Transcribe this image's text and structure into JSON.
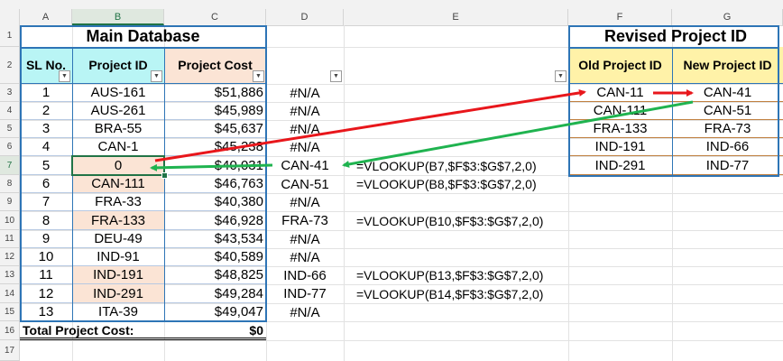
{
  "columns": [
    "A",
    "B",
    "C",
    "D",
    "E",
    "F",
    "G"
  ],
  "rows": [
    "1",
    "2",
    "3",
    "4",
    "5",
    "6",
    "7",
    "8",
    "9",
    "10",
    "11",
    "12",
    "13",
    "14",
    "15",
    "16",
    "17"
  ],
  "main_db": {
    "title": "Main Database",
    "headers": [
      "SL No.",
      "Project ID",
      "Project Cost"
    ],
    "records": [
      {
        "sl": "1",
        "id": "AUS-161",
        "cost": "$51,886",
        "result": "#N/A",
        "formula": ""
      },
      {
        "sl": "2",
        "id": "AUS-261",
        "cost": "$45,989",
        "result": "#N/A",
        "formula": ""
      },
      {
        "sl": "3",
        "id": "BRA-55",
        "cost": "$45,637",
        "result": "#N/A",
        "formula": ""
      },
      {
        "sl": "4",
        "id": "CAN-1",
        "cost": "$45,238",
        "result": "#N/A",
        "formula": ""
      },
      {
        "sl": "5",
        "id": "0",
        "cost": "$40,031",
        "result": "CAN-41",
        "formula": "=VLOOKUP(B7,$F$3:$G$7,2,0)"
      },
      {
        "sl": "6",
        "id": "CAN-111",
        "cost": "$46,763",
        "result": "CAN-51",
        "formula": "=VLOOKUP(B8,$F$3:$G$7,2,0)"
      },
      {
        "sl": "7",
        "id": "FRA-33",
        "cost": "$40,380",
        "result": "#N/A",
        "formula": ""
      },
      {
        "sl": "8",
        "id": "FRA-133",
        "cost": "$46,928",
        "result": "FRA-73",
        "formula": "=VLOOKUP(B10,$F$3:$G$7,2,0)"
      },
      {
        "sl": "9",
        "id": "DEU-49",
        "cost": "$43,534",
        "result": "#N/A",
        "formula": ""
      },
      {
        "sl": "10",
        "id": "IND-91",
        "cost": "$40,589",
        "result": "#N/A",
        "formula": ""
      },
      {
        "sl": "11",
        "id": "IND-191",
        "cost": "$48,825",
        "result": "IND-66",
        "formula": "=VLOOKUP(B13,$F$3:$G$7,2,0)"
      },
      {
        "sl": "12",
        "id": "IND-291",
        "cost": "$49,284",
        "result": "IND-77",
        "formula": "=VLOOKUP(B14,$F$3:$G$7,2,0)"
      },
      {
        "sl": "13",
        "id": "ITA-39",
        "cost": "$49,047",
        "result": "#N/A",
        "formula": ""
      }
    ],
    "highlighted_ids": [
      "0",
      "CAN-111",
      "FRA-133",
      "IND-191",
      "IND-291"
    ],
    "total_label": "Total Project Cost:",
    "total_value": "$0"
  },
  "revised": {
    "title": "Revised Project ID",
    "headers": [
      "Old Project ID",
      "New Project ID"
    ],
    "records": [
      {
        "old": "CAN-11",
        "new": "CAN-41"
      },
      {
        "old": "CAN-111",
        "new": "CAN-51"
      },
      {
        "old": "FRA-133",
        "new": "FRA-73"
      },
      {
        "old": "IND-191",
        "new": "IND-66"
      },
      {
        "old": "IND-291",
        "new": "IND-77"
      }
    ]
  },
  "colors": {
    "table_border": "#2e75b6",
    "header_cyan": "#b9f5f5",
    "header_peach": "#fbe4d5",
    "header_yellow": "#fff2a8",
    "arrow_red": "#e8161b",
    "arrow_green": "#1fb34f",
    "selection": "#217346"
  },
  "icons": {
    "filter_dropdown": "dropdown-arrow-icon"
  }
}
